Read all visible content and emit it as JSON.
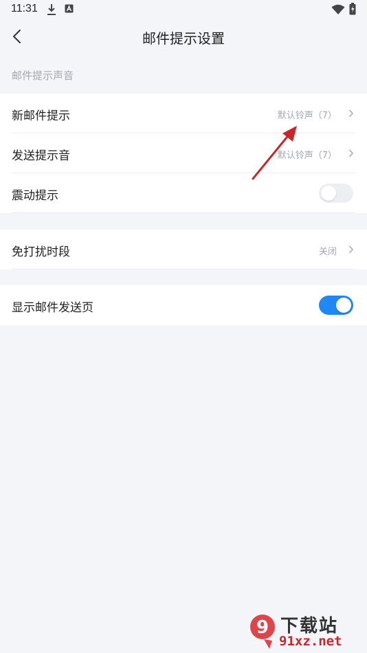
{
  "status_bar": {
    "time": "11:31",
    "left_icons": [
      "download-icon",
      "a-badge-icon"
    ],
    "right_icons": [
      "wifi-icon",
      "battery-icon"
    ]
  },
  "header": {
    "title": "邮件提示设置",
    "back_icon": "back-arrow-icon"
  },
  "section": {
    "label": "邮件提示声音"
  },
  "group1": {
    "rows": [
      {
        "label": "新邮件提示",
        "value": "默认铃声（7）",
        "type": "chevron"
      },
      {
        "label": "发送提示音",
        "value": "默认铃声（7）",
        "type": "chevron"
      },
      {
        "label": "震动提示",
        "type": "toggle",
        "enabled": false
      }
    ]
  },
  "group2": {
    "rows": [
      {
        "label": "免打扰时段",
        "value": "关闭",
        "type": "chevron"
      }
    ]
  },
  "group3": {
    "rows": [
      {
        "label": "显示邮件发送页",
        "type": "toggle",
        "enabled": true
      }
    ]
  },
  "colors": {
    "accent": "#1e88f5",
    "background": "#f4f5f9",
    "secondary_text": "#a5a8b0",
    "annotation_arrow": "#c8262b"
  },
  "watermark": {
    "text": "下载站",
    "url": "91xz.net",
    "logo_text": "9"
  }
}
